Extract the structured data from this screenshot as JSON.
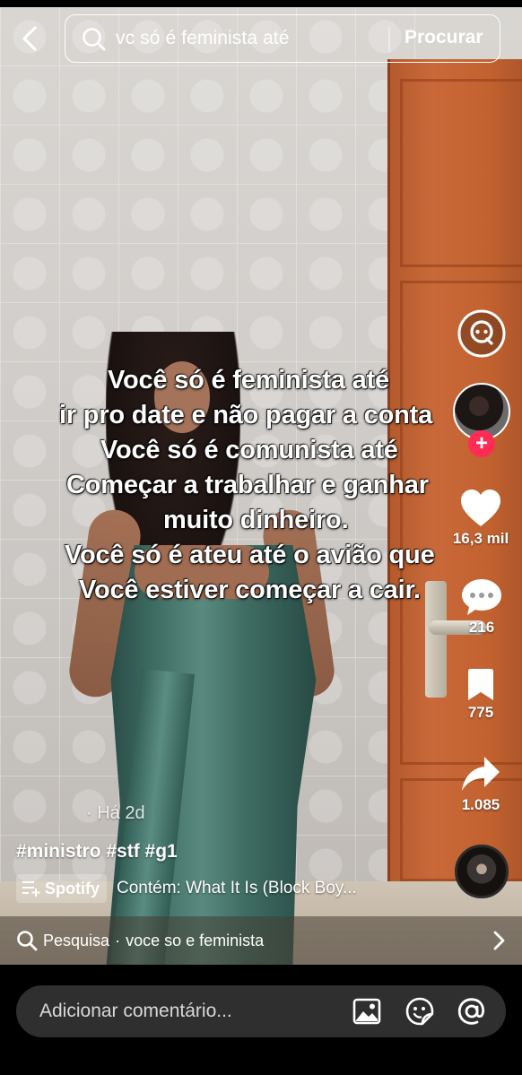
{
  "search": {
    "query": "vc só é feminista até",
    "submit_label": "Procurar"
  },
  "video": {
    "caption_lines": [
      "Você só é feminista até",
      "ir pro date e não pagar a conta",
      "Você só é comunista até",
      "Começar a trabalhar e ganhar",
      "muito dinheiro.",
      "Você só é ateu até o avião que",
      "Você estiver começar a cair."
    ],
    "posted": "· Há 2d",
    "hashtags": "#ministro #stf #g1"
  },
  "actions": {
    "likes": "16,3 mil",
    "comments": "216",
    "saves": "775",
    "shares": "1.085"
  },
  "music": {
    "source_label": "Spotify",
    "title": "Contém: What It Is (Block Boy..."
  },
  "related_search": {
    "prefix": "Pesquisa",
    "separator": "·",
    "query": "voce so e feminista"
  },
  "comment": {
    "placeholder": "Adicionar comentário..."
  },
  "icons": {
    "back": "chevron-left-icon",
    "search": "search-icon",
    "like": "heart-icon",
    "comment": "speech-bubble-icon",
    "save": "bookmark-icon",
    "share": "share-arrow-icon",
    "image": "image-icon",
    "emoji": "sticker-icon",
    "mention": "at-icon"
  },
  "colors": {
    "follow_accent": "#fe2c55",
    "comment_box": "#2f2f2f"
  }
}
